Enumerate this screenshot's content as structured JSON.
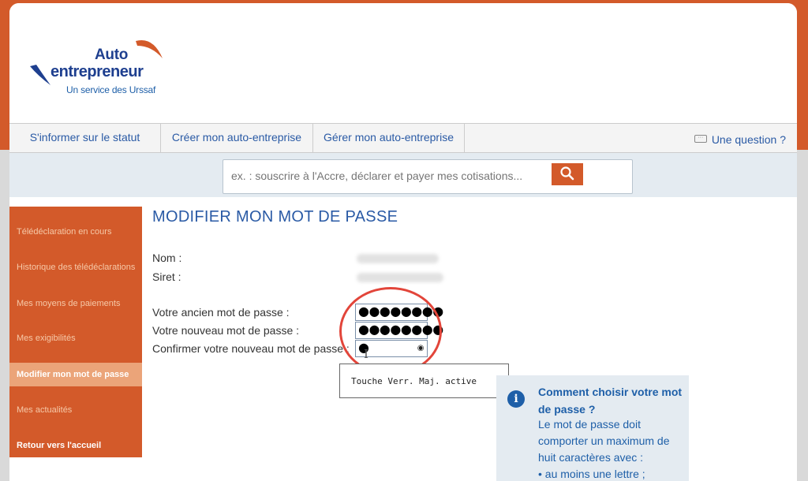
{
  "logo": {
    "line1": "Auto",
    "line2": "entrepreneur",
    "subline": "Un service des Urssaf"
  },
  "nav": {
    "items": [
      {
        "label": "S'informer sur le statut"
      },
      {
        "label": "Créer mon auto-entreprise"
      },
      {
        "label": "Gérer mon auto-entreprise"
      }
    ],
    "question": "Une question ?"
  },
  "search": {
    "placeholder": "ex. : souscrire à l'Accre, déclarer et payer mes cotisations..."
  },
  "sidebar": {
    "items": [
      {
        "label": "Télédéclaration en cours"
      },
      {
        "label": "Historique des télédéclarations"
      },
      {
        "label": "Mes moyens de paiements"
      },
      {
        "label": "Mes exigibilités"
      },
      {
        "label": "Modifier mon mot de passe"
      },
      {
        "label": "Mes actualités"
      },
      {
        "label": "Retour vers l'accueil"
      }
    ]
  },
  "form": {
    "title": "MODIFIER MON MOT DE PASSE",
    "nom_label": "Nom :",
    "siret_label": "Siret :",
    "old_label": "Votre ancien mot de passe :",
    "new_label": "Votre nouveau mot de passe :",
    "confirm_label": "Confirmer votre nouveau mot de passe :",
    "old_value": "●●●●●●●●",
    "new_value": "●●●●●●●●",
    "confirm_value": "●"
  },
  "tooltip": {
    "text": "Touche Verr. Maj. active"
  },
  "help": {
    "title": "Comment choisir votre mot de passe ?",
    "text": "Le mot de passe doit comporter un maximum de huit caractères avec :",
    "bullet": "• au moins une lettre ;"
  },
  "colors": {
    "brand_orange": "#d35a2a",
    "brand_blue": "#2a5aa5",
    "highlight_red": "#e2453a"
  }
}
